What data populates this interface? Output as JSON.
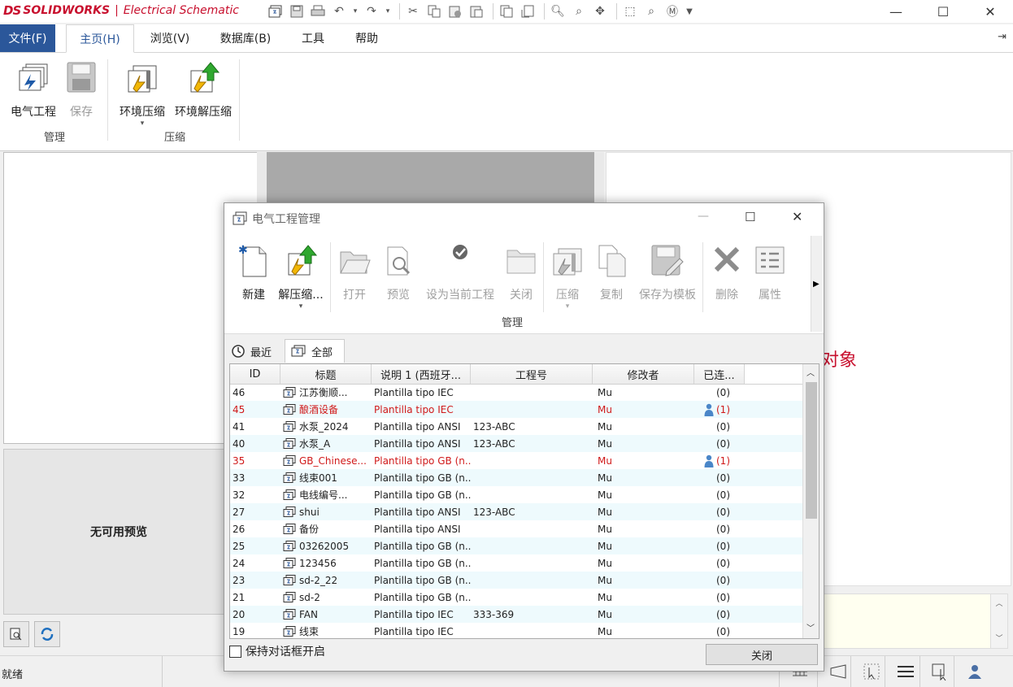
{
  "app": {
    "brand_ds": "DS",
    "brand_name": "SOLIDWORKS",
    "brand_sep": "|",
    "brand_product": "Electrical Schematic"
  },
  "window": {
    "minimize": "—",
    "maximize": "☐",
    "close": "✕"
  },
  "tabs": [
    {
      "label": "文件(F)"
    },
    {
      "label": "主页(H)"
    },
    {
      "label": "浏览(V)"
    },
    {
      "label": "数据库(B)"
    },
    {
      "label": "工具"
    },
    {
      "label": "帮助"
    }
  ],
  "ribbon": {
    "electrical_project": "电气工程",
    "save": "保存",
    "env_compress": "环境压缩",
    "env_decompress": "环境解压缩",
    "group_manage": "管理",
    "group_compress": "压缩"
  },
  "workspace": {
    "red_text": "对象",
    "no_preview": "无可用预览"
  },
  "status": {
    "text": "就绪"
  },
  "dialog": {
    "title": "电气工程管理",
    "buttons": {
      "new": "新建",
      "decompress": "解压缩...",
      "open": "打开",
      "preview": "预览",
      "set_current": "设为当前工程",
      "close": "关闭",
      "compress": "压缩",
      "copy": "复制",
      "save_template": "保存为模板",
      "delete": "删除",
      "properties": "属性"
    },
    "group_manage": "管理",
    "subtabs": {
      "recent": "最近",
      "all": "全部"
    },
    "columns": [
      "ID",
      "标题",
      "说明 1 (西班牙...",
      "工程号",
      "修改者",
      "已连..."
    ],
    "rows": [
      {
        "id": "46",
        "title": "江苏衡顺...",
        "desc": "Plantilla tipo IEC",
        "proj": "",
        "mod": "Mu",
        "conn": "(0)",
        "red": false,
        "user": false
      },
      {
        "id": "45",
        "title": "酿酒设备",
        "desc": "Plantilla tipo IEC",
        "proj": "",
        "mod": "Mu",
        "conn": "(1)",
        "red": true,
        "user": true
      },
      {
        "id": "41",
        "title": "水泵_2024",
        "desc": "Plantilla tipo ANSI",
        "proj": "123-ABC",
        "mod": "Mu",
        "conn": "(0)",
        "red": false,
        "user": false
      },
      {
        "id": "40",
        "title": "水泵_A",
        "desc": "Plantilla tipo ANSI",
        "proj": "123-ABC",
        "mod": "Mu",
        "conn": "(0)",
        "red": false,
        "user": false
      },
      {
        "id": "35",
        "title": "GB_Chinese...",
        "desc": "Plantilla tipo GB (n...",
        "proj": "",
        "mod": "Mu",
        "conn": "(1)",
        "red": true,
        "user": true
      },
      {
        "id": "33",
        "title": "线束001",
        "desc": "Plantilla tipo GB (n...",
        "proj": "",
        "mod": "Mu",
        "conn": "(0)",
        "red": false,
        "user": false
      },
      {
        "id": "32",
        "title": "电线编号...",
        "desc": "Plantilla tipo GB (n...",
        "proj": "",
        "mod": "Mu",
        "conn": "(0)",
        "red": false,
        "user": false
      },
      {
        "id": "27",
        "title": "shui",
        "desc": "Plantilla tipo ANSI",
        "proj": "123-ABC",
        "mod": "Mu",
        "conn": "(0)",
        "red": false,
        "user": false
      },
      {
        "id": "26",
        "title": "备份",
        "desc": "Plantilla tipo ANSI",
        "proj": "",
        "mod": "Mu",
        "conn": "(0)",
        "red": false,
        "user": false
      },
      {
        "id": "25",
        "title": "03262005",
        "desc": "Plantilla tipo GB (n...",
        "proj": "",
        "mod": "Mu",
        "conn": "(0)",
        "red": false,
        "user": false
      },
      {
        "id": "24",
        "title": "123456",
        "desc": "Plantilla tipo GB (n...",
        "proj": "",
        "mod": "Mu",
        "conn": "(0)",
        "red": false,
        "user": false
      },
      {
        "id": "23",
        "title": "sd-2_22",
        "desc": "Plantilla tipo GB (n...",
        "proj": "",
        "mod": "Mu",
        "conn": "(0)",
        "red": false,
        "user": false
      },
      {
        "id": "21",
        "title": "sd-2",
        "desc": "Plantilla tipo GB (n...",
        "proj": "",
        "mod": "Mu",
        "conn": "(0)",
        "red": false,
        "user": false
      },
      {
        "id": "20",
        "title": "FAN",
        "desc": "Plantilla tipo IEC",
        "proj": "333-369",
        "mod": "Mu",
        "conn": "(0)",
        "red": false,
        "user": false
      },
      {
        "id": "19",
        "title": "线束",
        "desc": "Plantilla tipo IEC",
        "proj": "",
        "mod": "Mu",
        "conn": "(0)",
        "red": false,
        "user": false
      }
    ],
    "keep_open": "保持对话框开启",
    "close_button": "关闭"
  },
  "colors": {
    "accent": "#2b579a",
    "brand_red": "#c8102e",
    "row_alt": "#eefafd",
    "row_red": "#d01a1a"
  }
}
